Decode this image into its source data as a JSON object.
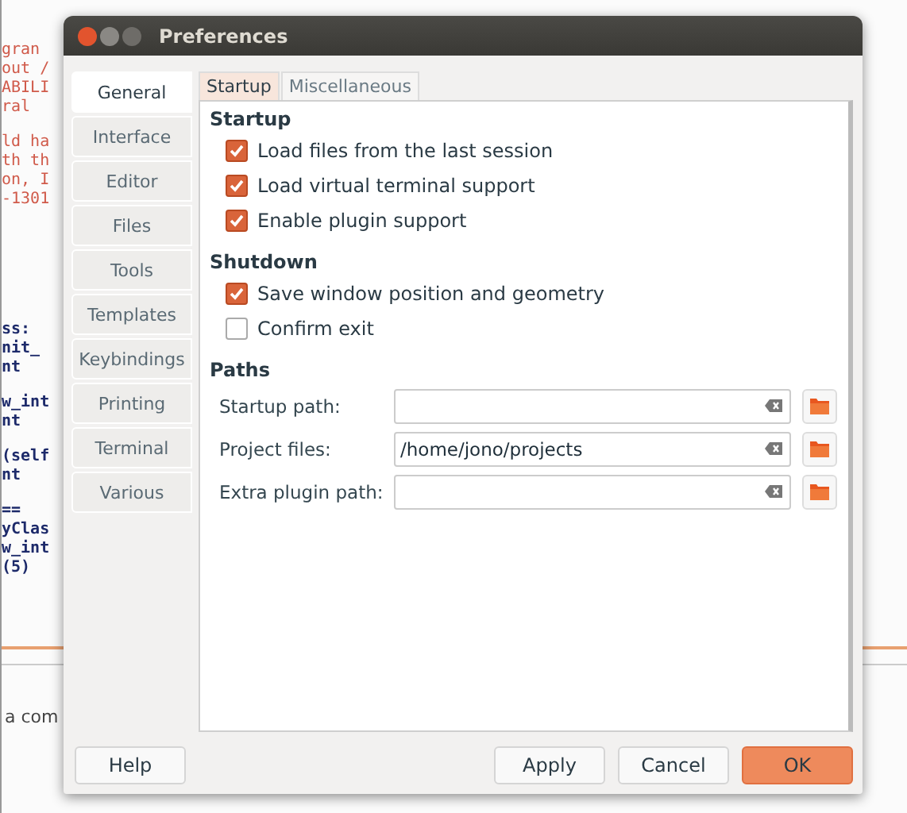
{
  "editor": {
    "blocks": [
      {
        "kind": "comment",
        "lines": [
          "gran",
          "out /",
          "ABILI",
          "ral"
        ]
      },
      {
        "kind": "comment",
        "lines": [
          "ld ha",
          "th th",
          "on, I",
          "-1301"
        ]
      },
      {
        "kind": "code",
        "lines": [
          "ss:",
          "nit_",
          "nt"
        ]
      },
      {
        "kind": "code",
        "lines": [
          "w_int",
          "nt"
        ]
      },
      {
        "kind": "code",
        "lines": [
          "(self",
          "nt"
        ]
      },
      {
        "kind": "code",
        "lines": [
          "==",
          "yClas",
          "w_int",
          "(5)"
        ]
      }
    ],
    "footer_text": "a com"
  },
  "dialog": {
    "title": "Preferences",
    "sections": [
      {
        "label": "General",
        "selected": true
      },
      {
        "label": "Interface",
        "selected": false
      },
      {
        "label": "Editor",
        "selected": false
      },
      {
        "label": "Files",
        "selected": false
      },
      {
        "label": "Tools",
        "selected": false
      },
      {
        "label": "Templates",
        "selected": false
      },
      {
        "label": "Keybindings",
        "selected": false
      },
      {
        "label": "Printing",
        "selected": false
      },
      {
        "label": "Terminal",
        "selected": false
      },
      {
        "label": "Various",
        "selected": false
      }
    ],
    "tabs": [
      {
        "label": "Startup",
        "selected": true
      },
      {
        "label": "Miscellaneous",
        "selected": false
      }
    ],
    "groups": [
      {
        "title": "Startup",
        "options": [
          {
            "label": "Load files from the last session",
            "checked": true
          },
          {
            "label": "Load virtual terminal support",
            "checked": true
          },
          {
            "label": "Enable plugin support",
            "checked": true
          }
        ]
      },
      {
        "title": "Shutdown",
        "options": [
          {
            "label": "Save window position and geometry",
            "checked": true
          },
          {
            "label": "Confirm exit",
            "checked": false
          }
        ]
      }
    ],
    "paths": {
      "title": "Paths",
      "fields": [
        {
          "label": "Startup path:"
        },
        {
          "label": "Project files:",
          "value": "/home/jono/projects"
        },
        {
          "label": "Extra plugin path:"
        }
      ]
    },
    "buttons": [
      {
        "label": "Help",
        "primary": false
      },
      {
        "label": "Apply",
        "primary": false
      },
      {
        "label": "Cancel",
        "primary": false
      },
      {
        "label": "OK",
        "primary": true
      }
    ]
  }
}
